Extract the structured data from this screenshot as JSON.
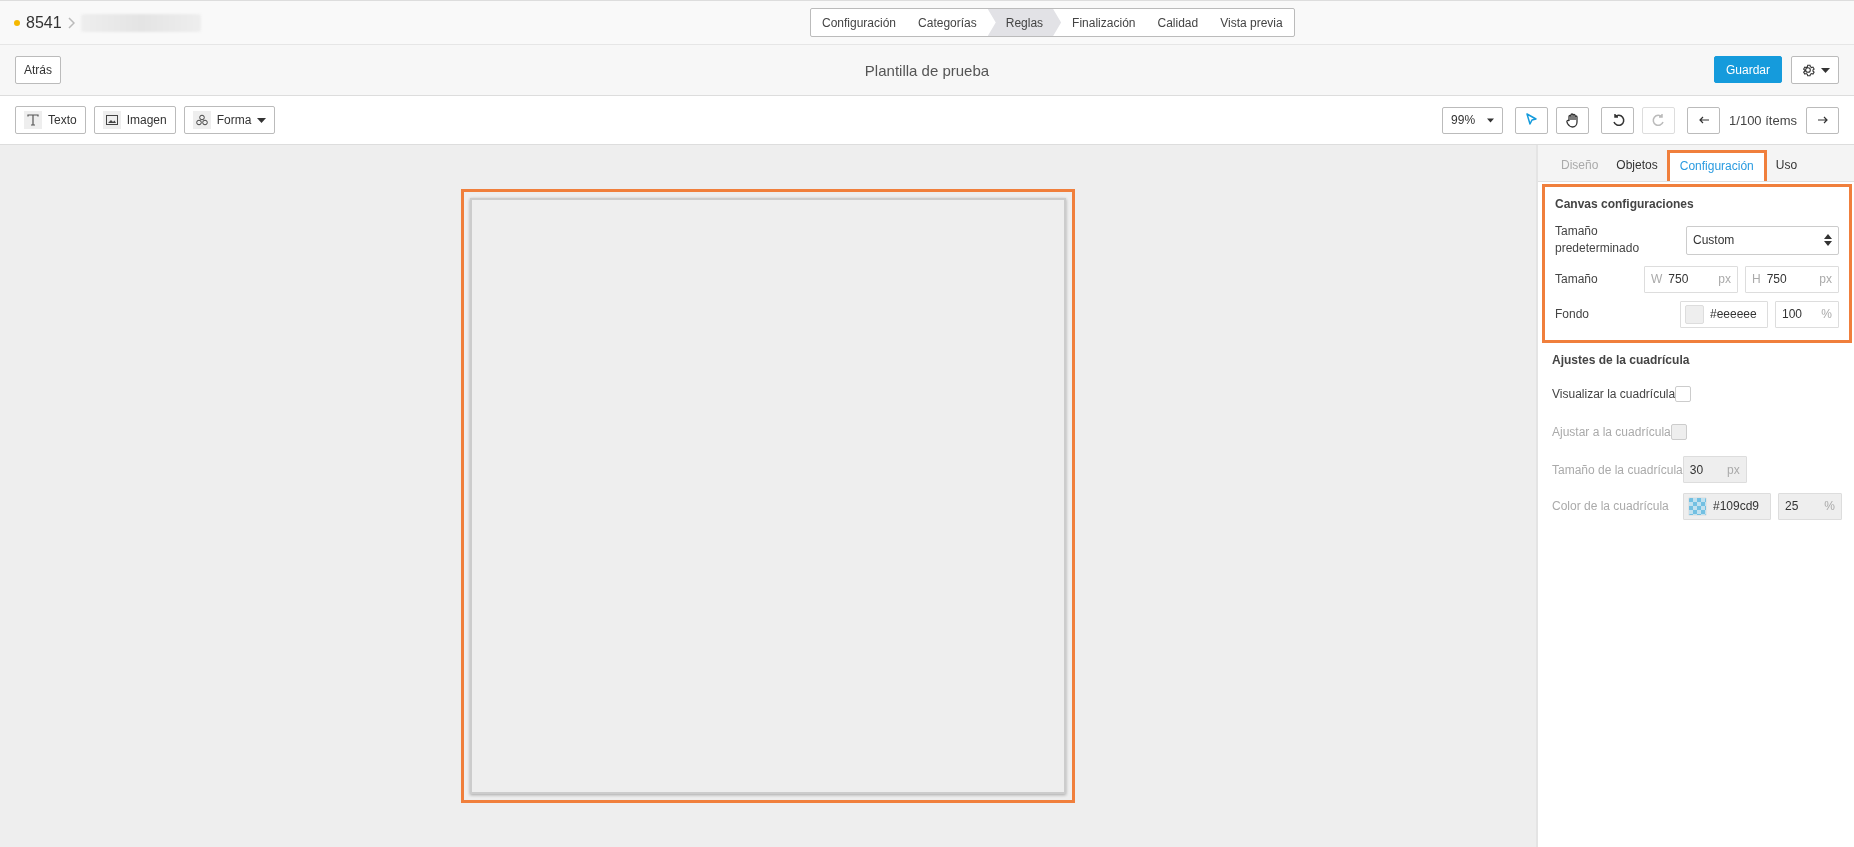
{
  "breadcrumb": {
    "id": "8541"
  },
  "steps": [
    {
      "label": "Configuración",
      "selected": false
    },
    {
      "label": "Categorías",
      "selected": false
    },
    {
      "label": "Reglas",
      "selected": true
    },
    {
      "label": "Finalización",
      "selected": false
    },
    {
      "label": "Calidad",
      "selected": false
    },
    {
      "label": "Vista previa",
      "selected": false
    }
  ],
  "header": {
    "back": "Atrás",
    "title": "Plantilla de prueba",
    "save": "Guardar"
  },
  "toolbar": {
    "tools": [
      {
        "label": "Texto",
        "kind": "text"
      },
      {
        "label": "Imagen",
        "kind": "image"
      },
      {
        "label": "Forma",
        "kind": "shape"
      }
    ],
    "zoom": "99%",
    "modes": [
      {
        "kind": "select",
        "selected": true
      },
      {
        "kind": "pan",
        "selected": false
      }
    ],
    "history": [
      {
        "kind": "undo",
        "disabled": false
      },
      {
        "kind": "redo",
        "disabled": true
      }
    ],
    "pager": "1/100 ítems"
  },
  "panel": {
    "tabs": [
      {
        "label": "Diseño",
        "selected": false,
        "disabled": true
      },
      {
        "label": "Objetos",
        "selected": false,
        "disabled": false
      },
      {
        "label": "Configuración",
        "selected": true,
        "disabled": false
      },
      {
        "label": "Uso",
        "selected": false,
        "disabled": false
      }
    ],
    "canvas_section": {
      "title": "Canvas configuraciones",
      "preset_label": "Tamaño predeterminado",
      "preset_value": "Custom",
      "size_label": "Tamaño",
      "width": {
        "prefix": "W",
        "value": "750",
        "unit": "px"
      },
      "height": {
        "prefix": "H",
        "value": "750",
        "unit": "px"
      },
      "background_label": "Fondo",
      "background_color": "#eeeeee",
      "opacity": "100",
      "opacity_unit": "%"
    },
    "grid_section": {
      "title": "Ajustes de la cuadrícula",
      "show": {
        "label": "Visualizar la cuadrícula",
        "checked": false,
        "disabled": false
      },
      "snap": {
        "label": "Ajustar a la cuadrícula",
        "checked": false,
        "disabled": true
      },
      "size": {
        "label": "Tamaño de la cuadrícula",
        "value": "30",
        "unit": "px",
        "disabled": true
      },
      "color": {
        "label": "Color de la cuadrícula",
        "value": "#109cd9",
        "opacity": "25",
        "unit": "%",
        "disabled": true
      }
    }
  }
}
